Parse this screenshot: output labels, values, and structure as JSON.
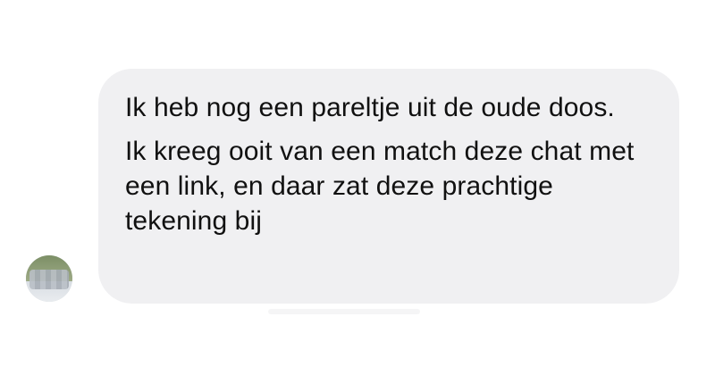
{
  "conversation": {
    "received_message": {
      "paragraphs": [
        "Ik heb nog een pareltje uit de oude doos.",
        "Ik kreeg ooit van een match deze chat met een link, en daar zat deze prachtige tekening bij"
      ]
    },
    "sender_avatar": {
      "icon": "avatar-photo-blurred"
    }
  },
  "colors": {
    "bubble_background": "#f0f0f2",
    "text": "#111111",
    "page_background": "#ffffff"
  }
}
